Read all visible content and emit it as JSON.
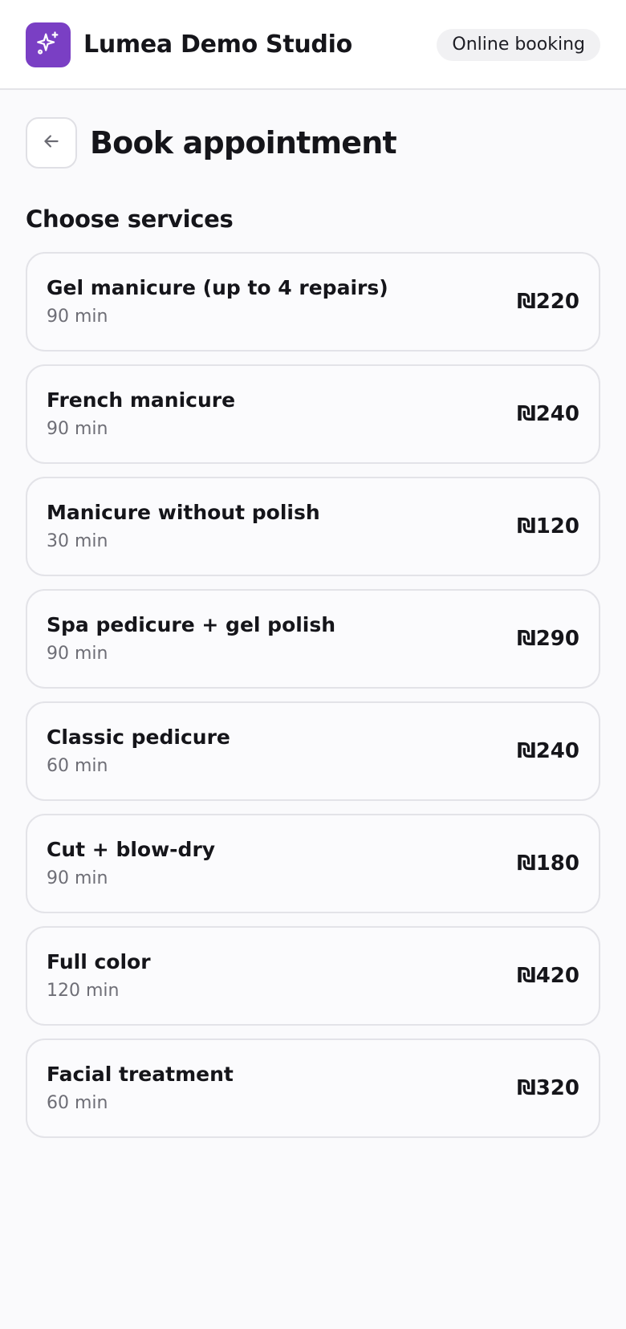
{
  "header": {
    "logo_icon": "sparkles-icon",
    "studio_name": "Lumea Demo Studio",
    "badge": "Online booking",
    "brand_color": "#7a3fc4"
  },
  "page": {
    "back_icon": "arrow-left-icon",
    "title": "Book appointment"
  },
  "services": {
    "heading": "Choose services",
    "items": [
      {
        "name": "Gel manicure (up to 4 repairs)",
        "duration": "90 min",
        "price": "₪220"
      },
      {
        "name": "French manicure",
        "duration": "90 min",
        "price": "₪240"
      },
      {
        "name": "Manicure without polish",
        "duration": "30 min",
        "price": "₪120"
      },
      {
        "name": "Spa pedicure + gel polish",
        "duration": "90 min",
        "price": "₪290"
      },
      {
        "name": "Classic pedicure",
        "duration": "60 min",
        "price": "₪240"
      },
      {
        "name": "Cut + blow-dry",
        "duration": "90 min",
        "price": "₪180"
      },
      {
        "name": "Full color",
        "duration": "120 min",
        "price": "₪420"
      },
      {
        "name": "Facial treatment",
        "duration": "60 min",
        "price": "₪320"
      }
    ]
  }
}
